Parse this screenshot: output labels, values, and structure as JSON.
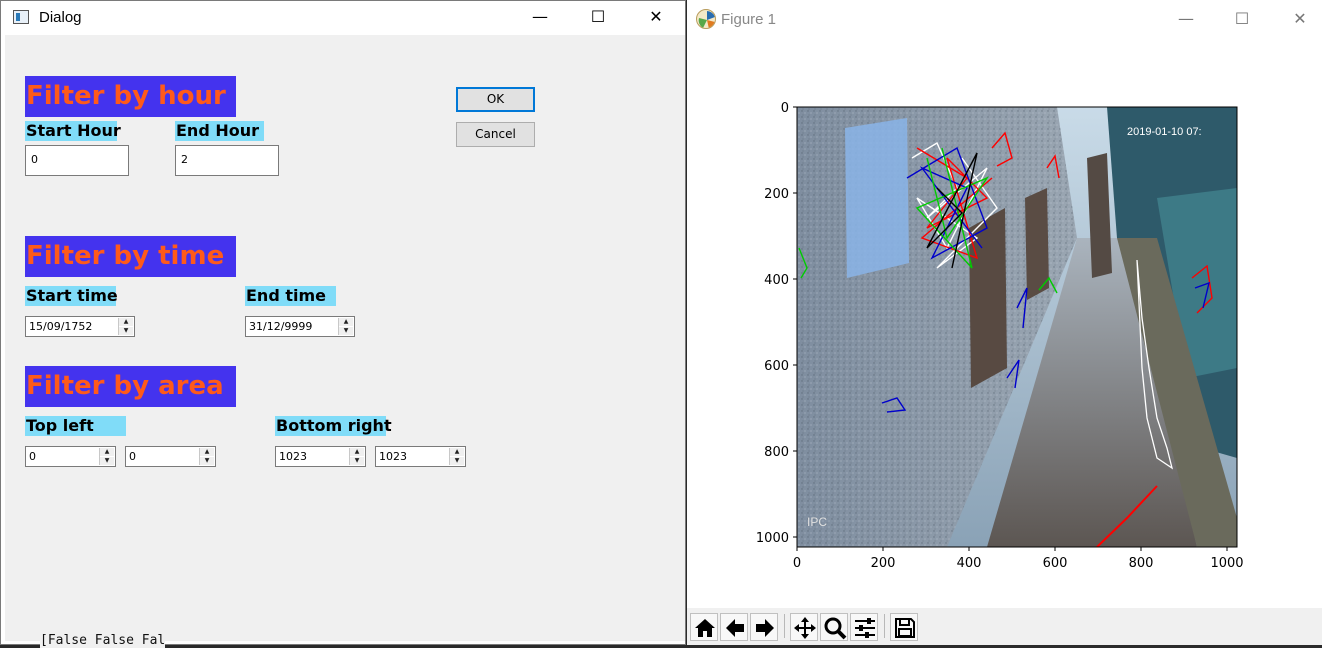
{
  "dialog": {
    "title": "Dialog",
    "minimize": "—",
    "maximize": "☐",
    "close": "✕",
    "hour": {
      "header": "Filter by hour",
      "start_label": "Start Hour",
      "start_value": "0",
      "end_label": "End Hour",
      "end_value": "2"
    },
    "time": {
      "header": "Filter by time",
      "start_label": "Start time",
      "start_value": "15/09/1752",
      "end_label": "End time",
      "end_value": "31/12/9999"
    },
    "area": {
      "header": "Filter by area",
      "topleft_label": "Top left",
      "topleft_x": "0",
      "topleft_y": "0",
      "bottomright_label": "Bottom right",
      "bottomright_x": "1023",
      "bottomright_y": "1023"
    },
    "ok_label": "OK",
    "cancel_label": "Cancel"
  },
  "figure": {
    "title": "Figure 1",
    "minimize": "—",
    "maximize": "☐",
    "close": "✕",
    "image_overlay_text": "2019-01-10 07:",
    "image_corner_text": "IPC",
    "x_ticks": [
      "0",
      "200",
      "400",
      "600",
      "800",
      "1000"
    ],
    "y_ticks": [
      "0",
      "200",
      "400",
      "600",
      "800",
      "1000"
    ],
    "toolbar": [
      "home-icon",
      "back-icon",
      "forward-icon",
      "pan-icon",
      "zoom-icon",
      "configure-icon",
      "save-icon"
    ]
  },
  "background_text": "[False False Fal"
}
